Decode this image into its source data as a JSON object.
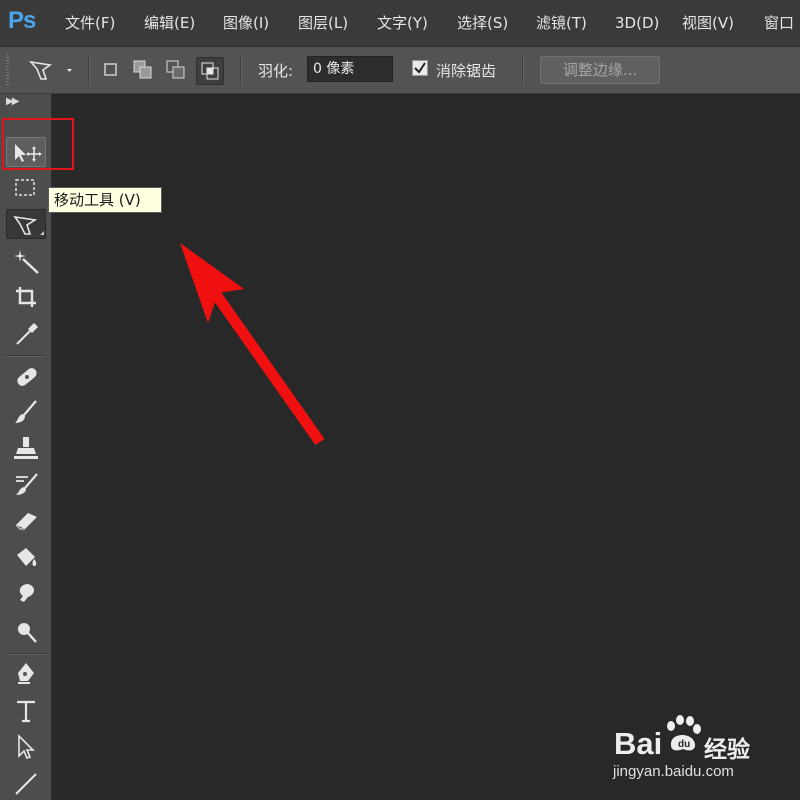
{
  "app": {
    "logo": "Ps"
  },
  "menu": {
    "items": [
      {
        "label": "文件(F)"
      },
      {
        "label": "编辑(E)"
      },
      {
        "label": "图像(I)"
      },
      {
        "label": "图层(L)"
      },
      {
        "label": "文字(Y)"
      },
      {
        "label": "选择(S)"
      },
      {
        "label": "滤镜(T)"
      },
      {
        "label": "3D(D)"
      },
      {
        "label": "视图(V)"
      },
      {
        "label": "窗口"
      }
    ]
  },
  "options": {
    "feather_label": "羽化:",
    "feather_value": "0 像素",
    "antialias_label": "消除锯齿",
    "antialias_checked": true,
    "refine_edge_label": "调整边缘..."
  },
  "toolbox": {
    "tools": [
      {
        "name": "move-tool",
        "icon": "move-icon",
        "state": "selected"
      },
      {
        "name": "marquee-tool",
        "icon": "rect-marquee-icon"
      },
      {
        "name": "lasso-tool",
        "icon": "polygon-lasso-icon",
        "state": "active"
      },
      {
        "name": "magic-wand-tool",
        "icon": "magic-wand-icon"
      },
      {
        "name": "crop-tool",
        "icon": "crop-icon"
      },
      {
        "name": "eyedropper-tool",
        "icon": "eyedropper-icon"
      },
      {
        "name": "healing-tool",
        "icon": "bandage-icon"
      },
      {
        "name": "brush-tool",
        "icon": "brush-icon"
      },
      {
        "name": "stamp-tool",
        "icon": "stamp-icon"
      },
      {
        "name": "history-brush-tool",
        "icon": "history-brush-icon"
      },
      {
        "name": "eraser-tool",
        "icon": "eraser-icon"
      },
      {
        "name": "paint-bucket-tool",
        "icon": "paint-bucket-icon"
      },
      {
        "name": "blur-tool",
        "icon": "blur-icon"
      },
      {
        "name": "dodge-tool",
        "icon": "dodge-icon"
      },
      {
        "name": "pen-tool",
        "icon": "pen-icon"
      },
      {
        "name": "type-tool",
        "icon": "type-icon"
      },
      {
        "name": "path-select-tool",
        "icon": "path-select-icon"
      },
      {
        "name": "line-tool",
        "icon": "line-icon"
      }
    ]
  },
  "tooltip": {
    "text": "移动工具 (V)"
  },
  "watermark": {
    "brand": "Bai",
    "brand_cn": "经验",
    "url": "jingyan.baidu.com"
  },
  "colors": {
    "accent": "#4aa4ec",
    "highlight": "#e0161a",
    "arrow": "#f01010",
    "tooltip_bg": "#ffffe1"
  }
}
